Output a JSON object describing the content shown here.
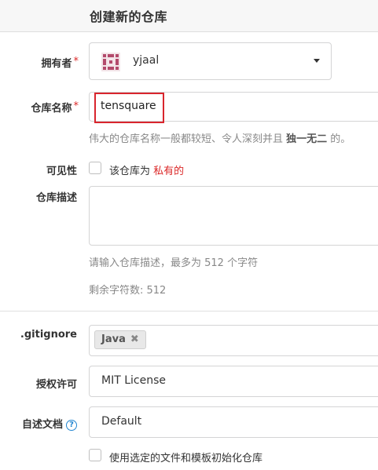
{
  "header": {
    "title": "创建新的仓库"
  },
  "owner": {
    "label": "拥有者",
    "required_mark": "*",
    "name": "yjaal"
  },
  "repo_name": {
    "label": "仓库名称",
    "required_mark": "*",
    "value": "tensquare",
    "help_prefix": "伟大的仓库名称一般都较短、令人深刻并且 ",
    "help_strong": "独一无二",
    "help_suffix": " 的。"
  },
  "visibility": {
    "label": "可见性",
    "checkbox_text": "该仓库为 ",
    "private_text": "私有的"
  },
  "description": {
    "label": "仓库描述",
    "help": "请输入仓库描述，最多为 512 个字符",
    "remaining": "剩余字符数: 512"
  },
  "gitignore": {
    "label": ".gitignore",
    "tag": "Java",
    "remove": "✖"
  },
  "license": {
    "label": "授权许可",
    "value": "MIT License"
  },
  "readme": {
    "label": "自述文档",
    "help_icon": "?",
    "value": "Default"
  },
  "init": {
    "checkbox_text": "使用选定的文件和模板初始化仓库"
  },
  "colors": {
    "required": "#db2828",
    "highlight": "#d9252d",
    "help_icon": "#2185d0"
  }
}
